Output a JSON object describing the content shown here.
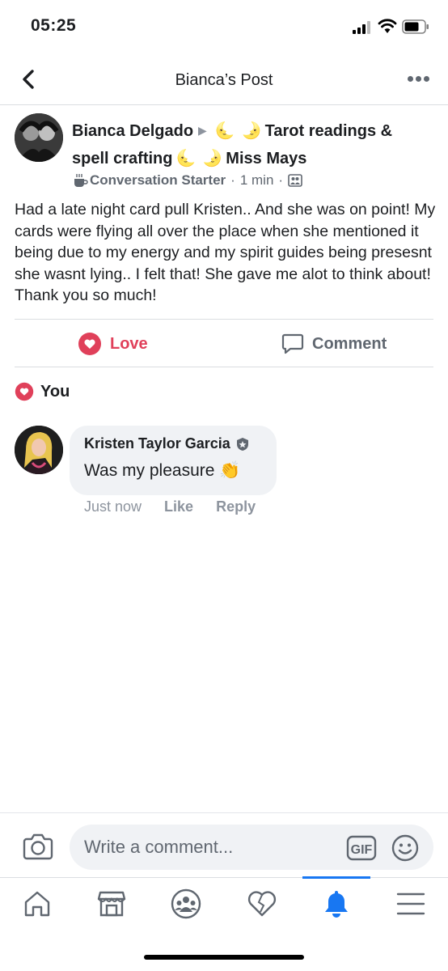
{
  "status": {
    "time": "05:25"
  },
  "header": {
    "title": "Bianca’s Post"
  },
  "post": {
    "author": "Bianca Delgado",
    "group_line1": "Tarot readings &",
    "group_line2_a": "spell crafting",
    "group_line2_b": "Miss Mays",
    "moon_left": "🌜",
    "moon_right": "🌛",
    "badge": "Conversation Starter",
    "time": "1 min",
    "body": "Had a late night card pull Kristen.. And she was on point! My cards were flying all over the place when she mentioned it being due to my energy and my spirit guides being presesnt she wasnt lying.. I felt that! She gave me alot to think about! Thank you so much!"
  },
  "actions": {
    "love": "Love",
    "comment": "Comment"
  },
  "reactions": {
    "label": "You"
  },
  "comment": {
    "author": "Kristen Taylor Garcia",
    "text": "Was my pleasure",
    "emoji": "👏",
    "time": "Just now",
    "like": "Like",
    "reply": "Reply"
  },
  "composer": {
    "placeholder": "Write a comment...",
    "gif": "GIF"
  },
  "colors": {
    "love": "#e0405a",
    "accent": "#1877f2",
    "muted": "#606770"
  },
  "tabs": [
    "home-icon",
    "marketplace-icon",
    "groups-icon",
    "dating-icon",
    "notifications-icon",
    "menu-icon"
  ]
}
